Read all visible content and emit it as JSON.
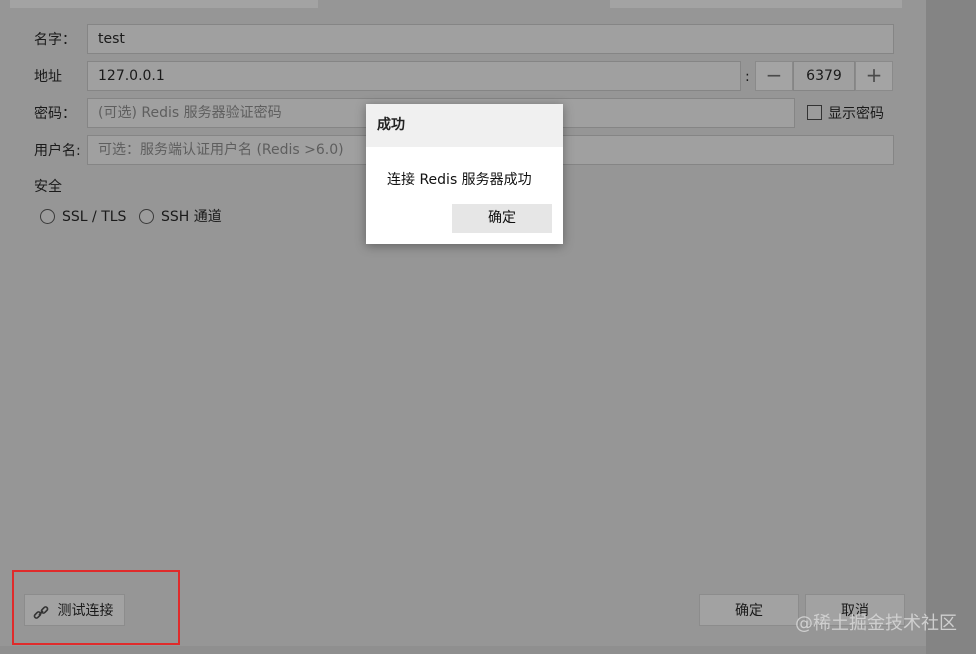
{
  "form": {
    "name_label": "名字：",
    "name_value": "test",
    "address_label": "地址",
    "address_value": "127.0.0.1",
    "port_separator": ":",
    "port_minus": "−",
    "port_value": "6379",
    "port_plus": "+",
    "password_label": "密码：",
    "password_placeholder": "(可选) Redis 服务器验证密码",
    "show_password_label": "显示密码",
    "username_label": "用户名:",
    "username_placeholder": "可选：服务端认证用户名 (Redis >6.0)",
    "security_label": "安全",
    "ssl_label": "SSL / TLS",
    "ssh_label": "SSH 通道"
  },
  "footer": {
    "test_connection_label": "测试连接",
    "ok_label": "确定",
    "cancel_label": "取消"
  },
  "dialog": {
    "title": "成功",
    "message": "连接 Redis 服务器成功",
    "ok_label": "确定"
  },
  "watermark": "@稀土掘金技术社区",
  "icons": {
    "test_connection": "link-icon"
  },
  "colors": {
    "overlay": "#969696",
    "highlight": "#e02b2b",
    "dialog_bg": "#ffffff"
  }
}
